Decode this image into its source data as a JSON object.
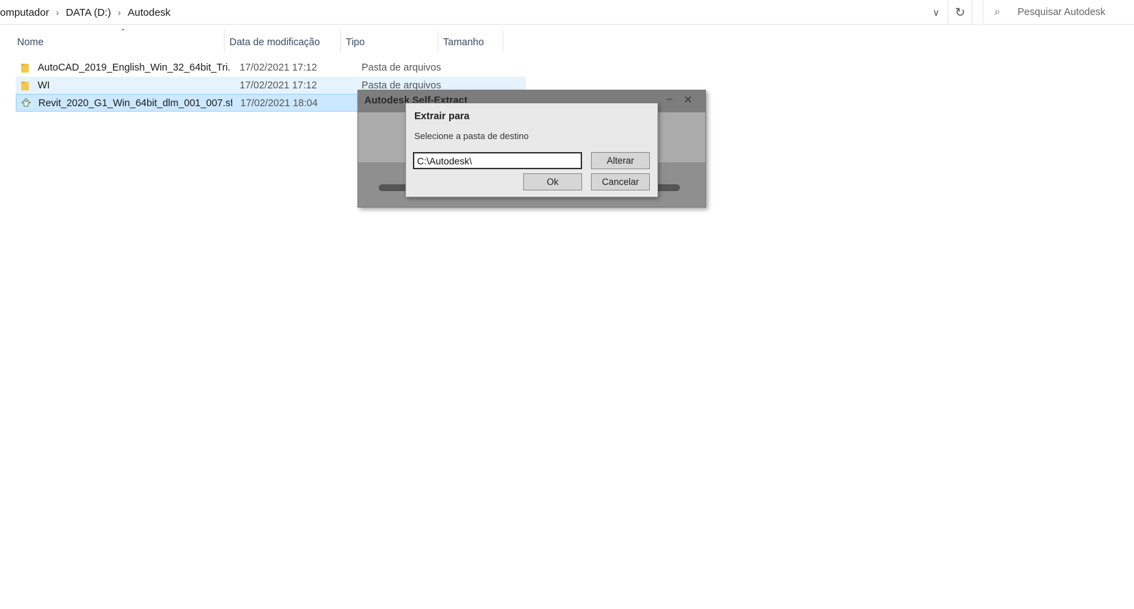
{
  "breadcrumb": {
    "items": [
      "omputador",
      "DATA (D:)",
      "Autodesk"
    ]
  },
  "search": {
    "placeholder": "Pesquisar Autodesk"
  },
  "columns": {
    "name": "Nome",
    "date": "Data de modificação",
    "type": "Tipo",
    "size": "Tamanho"
  },
  "files": [
    {
      "name": "AutoCAD_2019_English_Win_32_64bit_Tri...",
      "date": "17/02/2021 17:12",
      "type": "Pasta de arquivos",
      "icon": "folder-icon"
    },
    {
      "name": "WI",
      "date": "17/02/2021 17:12",
      "type": "Pasta de arquivos",
      "icon": "folder-icon"
    },
    {
      "name": "Revit_2020_G1_Win_64bit_dlm_001_007.sfx",
      "date": "17/02/2021 18:04",
      "type": "",
      "icon": "sfx-file-icon"
    }
  ],
  "sfx_window": {
    "title": "Autodesk Self-Extract"
  },
  "dialog": {
    "title": "Extrair para",
    "label": "Selecione a pasta de destino",
    "path_value": "C:\\Autodesk\\",
    "change_label": "Alterar",
    "ok_label": "Ok",
    "cancel_label": "Cancelar"
  },
  "colors": {
    "selected_row": "#cce8ff",
    "hover_row": "#e5f3ff",
    "header_text": "#3a4a6a",
    "folder": "#f2c94c"
  }
}
